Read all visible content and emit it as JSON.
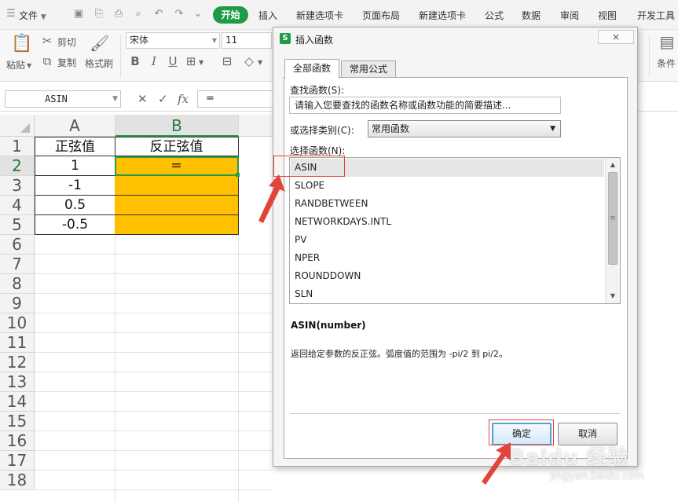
{
  "menubar": {
    "file_label": "文件",
    "tabs": [
      "开始",
      "插入",
      "新建选项卡",
      "页面布局",
      "新建选项卡",
      "公式",
      "数据",
      "审阅",
      "视图",
      "开发工具"
    ]
  },
  "ribbon": {
    "paste_label": "粘贴",
    "cut_label": "剪切",
    "copy_label": "复制",
    "format_painter_label": "格式刷",
    "font_name": "宋体",
    "font_size": "11",
    "conditions_label": "条件"
  },
  "formula_bar": {
    "name_box": "ASIN",
    "fx": "fx",
    "formula": "="
  },
  "sheet": {
    "columns": [
      "A",
      "B"
    ],
    "rows": [
      "1",
      "2",
      "3",
      "4",
      "5",
      "6",
      "7",
      "8",
      "9",
      "10",
      "11",
      "12",
      "13",
      "14",
      "15",
      "16",
      "17",
      "18"
    ],
    "selected_row": "2",
    "selected_col": "B",
    "cells": {
      "A1": "正弦值",
      "B1": "反正弦值",
      "A2": "1",
      "B2": "=",
      "A3": "-1",
      "A4": "0.5",
      "A5": "-0.5"
    },
    "highlight_color": "#ffc000"
  },
  "dialog": {
    "title": "插入函数",
    "app_icon": "S",
    "close_label": "×",
    "tabs": [
      "全部函数",
      "常用公式"
    ],
    "search_label": "查找函数(S):",
    "search_placeholder": "请输入您要查找的函数名称或函数功能的简要描述...",
    "category_label": "或选择类别(C):",
    "category_value": "常用函数",
    "list_label": "选择函数(N):",
    "functions": [
      "ASIN",
      "SLOPE",
      "RANDBETWEEN",
      "NETWORKDAYS.INTL",
      "PV",
      "NPER",
      "ROUNDDOWN",
      "SLN"
    ],
    "selected_function": "ASIN",
    "signature": "ASIN(number)",
    "description": "返回给定参数的反正弦。弧度值的范围为 -pi/2 到 pi/2。",
    "ok_label": "确定",
    "cancel_label": "取消"
  },
  "watermark": {
    "brand": "Baidu 经验",
    "url": "jingyan.baidu.com"
  },
  "colors": {
    "accent_green": "#1f9b47",
    "annotation_red": "#e4433b",
    "cell_orange": "#ffc000"
  }
}
